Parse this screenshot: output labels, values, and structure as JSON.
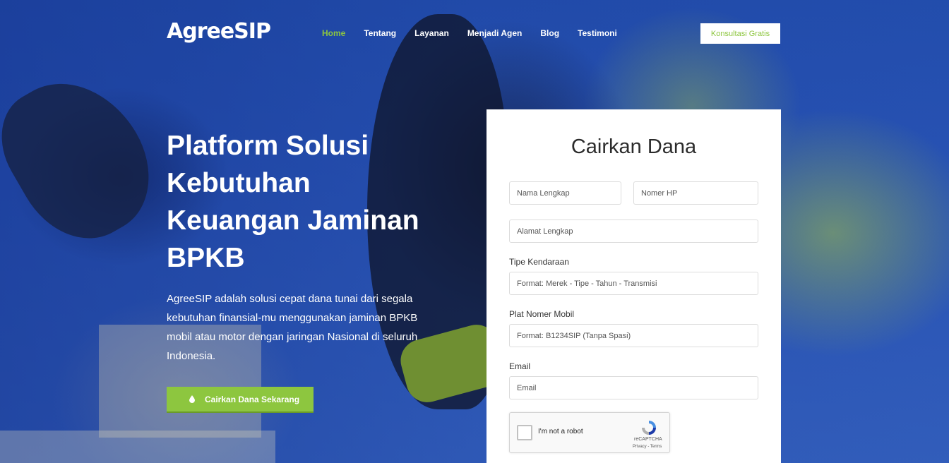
{
  "header": {
    "logo": "AgreeSIP",
    "nav": [
      "Home",
      "Tentang",
      "Layanan",
      "Menjadi Agen",
      "Blog",
      "Testimoni"
    ],
    "active_nav": "Home",
    "cta": "Konsultasi Gratis"
  },
  "hero": {
    "title": "Platform Solusi Kebutuhan Keuangan Jaminan BPKB",
    "description": "AgreeSIP adalah solusi cepat dana tunai dari segala kebutuhan finansial-mu menggunakan jaminan BPKB mobil atau motor dengan jaringan Nasional di seluruh Indonesia.",
    "button": "Cairkan Dana Sekarang",
    "button_icon": "drop-icon"
  },
  "form": {
    "title": "Cairkan Dana",
    "name_placeholder": "Nama Lengkap",
    "phone_placeholder": "Nomer HP",
    "address_placeholder": "Alamat Lengkap",
    "vehicle_label": "Tipe Kendaraan",
    "vehicle_placeholder": "Format: Merek - Tipe - Tahun - Transmisi",
    "plate_label": "Plat Nomer Mobil",
    "plate_placeholder": "Format: B1234SIP (Tanpa Spasi)",
    "email_label": "Email",
    "email_placeholder": "Email",
    "recaptcha": {
      "text": "I'm not a robot",
      "brand": "reCAPTCHA",
      "links": "Privacy - Terms"
    }
  },
  "colors": {
    "accent": "#8dc63f",
    "hero_bg": "#2a56b8"
  }
}
